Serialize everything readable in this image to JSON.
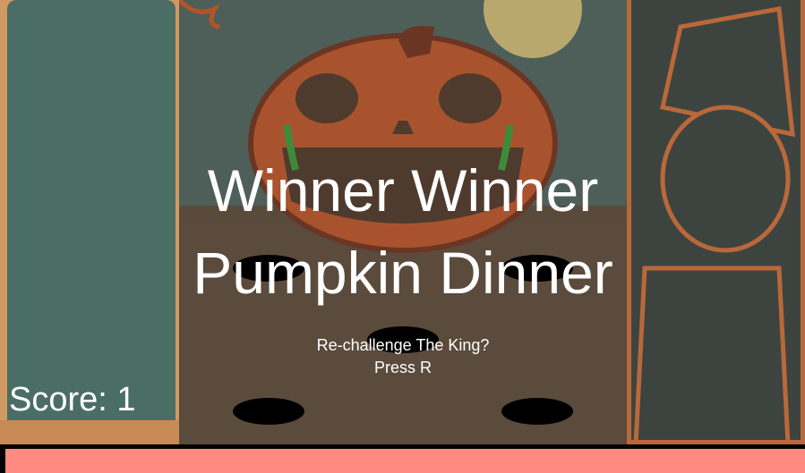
{
  "game": {
    "title_line1": "Winner Winner",
    "title_line2": "Pumpkin Dinner",
    "prompt_line1": "Re-challenge The King?",
    "prompt_line2": "Press R",
    "score_label": "Score: 1"
  },
  "colors": {
    "ground_bar": "#ff8a80",
    "text": "#ffffff",
    "pumpkin": "#b4532a",
    "hole": "#000000"
  }
}
